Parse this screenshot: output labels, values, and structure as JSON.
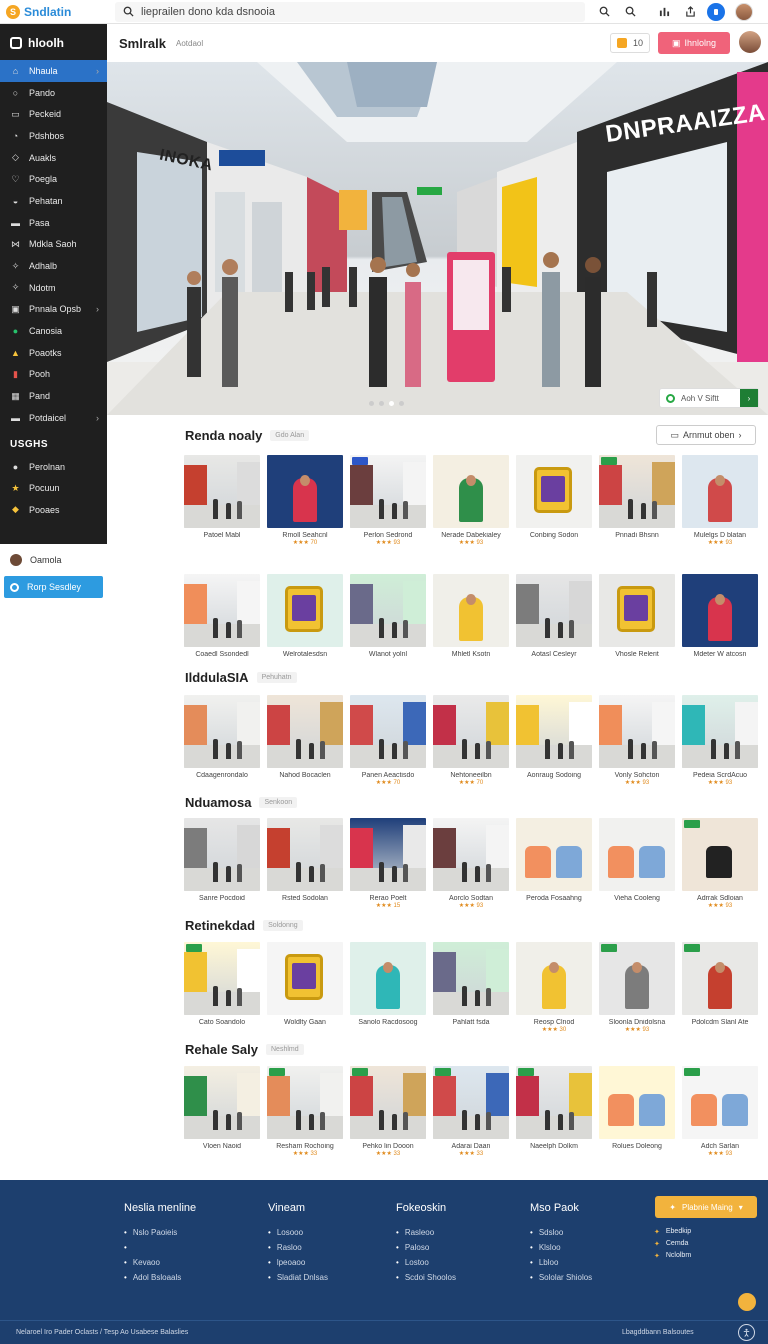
{
  "topbar": {
    "brand_letter": "S",
    "brand": "Sndlatin",
    "search_text": "lieprailen dono kda dsnooia"
  },
  "sidebar": {
    "header": "hloolh",
    "items": [
      {
        "label": "Nhaula",
        "icon": "home-icon",
        "active": true
      },
      {
        "label": "Pando",
        "icon": "circle-icon"
      },
      {
        "label": "Peckeid",
        "icon": "doc-icon"
      },
      {
        "label": "Pdshbos",
        "icon": "chat-icon"
      },
      {
        "label": "Auakls",
        "icon": "cart-icon"
      },
      {
        "label": "Poegla",
        "icon": "heart-icon"
      },
      {
        "label": "Pehatan",
        "icon": "bag-icon"
      },
      {
        "label": "Pasa",
        "icon": "card-icon"
      },
      {
        "label": "Mdkla Saoh",
        "icon": "filter-icon"
      },
      {
        "label": "Adhalb",
        "icon": "tool-icon"
      },
      {
        "label": "Ndotm",
        "icon": "tool-icon"
      },
      {
        "label": "Pnnala Opsb",
        "icon": "screen-icon"
      },
      {
        "label": "Canosia",
        "icon": "green-circle-icon"
      },
      {
        "label": "Poaotks",
        "icon": "yellow-icon"
      },
      {
        "label": "Pooh",
        "icon": "chart-icon"
      },
      {
        "label": "Pand",
        "icon": "grid-icon"
      },
      {
        "label": "Potdaicel",
        "icon": "card-icon"
      }
    ],
    "section": "USGHS",
    "section_items": [
      {
        "label": "Perolnan",
        "icon": "user-icon"
      },
      {
        "label": "Pocuun",
        "icon": "star-icon"
      },
      {
        "label": "Pooaes",
        "icon": "gift-icon"
      }
    ],
    "light_item": "Oamola",
    "button": "Rorp Sesdley"
  },
  "pagehead": {
    "title": "Smlralk",
    "sub": "Aotdaol",
    "chip_text": "10",
    "button": "Ihnlolng"
  },
  "hero": {
    "sign_main": "DNPRAAIZZA",
    "sign_left": "INOKA",
    "badge_text": "Aoh V Siftt",
    "dots": [
      false,
      false,
      true,
      false
    ]
  },
  "sections": [
    {
      "title": "Renda noaly",
      "tag": "Gdo Alan",
      "more": "Arnmut oben",
      "cards": [
        {
          "caption": "Patoel Mabl",
          "rating": ""
        },
        {
          "caption": "Rmoll Seahcnl",
          "rating": "★★★ 70"
        },
        {
          "caption": "Perlon Sedrond",
          "rating": "★★★ 93"
        },
        {
          "caption": "Nerade Dabekialey",
          "rating": "★★★ 93"
        },
        {
          "caption": "Conbing Sodon",
          "rating": ""
        },
        {
          "caption": "Pnnadi Bhsnn",
          "rating": ""
        },
        {
          "caption": "Mulelgs D blatan",
          "rating": "★★★ 93"
        }
      ]
    },
    {
      "title": "",
      "tag": "",
      "cards": [
        {
          "caption": "Coaedl Ssondedl",
          "rating": ""
        },
        {
          "caption": "Welrotalesdsn",
          "rating": ""
        },
        {
          "caption": "Wlanot yolnl",
          "rating": ""
        },
        {
          "caption": "Mhletl Ksotn",
          "rating": ""
        },
        {
          "caption": "Aotasl Cesleyr",
          "rating": ""
        },
        {
          "caption": "Vhosle Relerit",
          "rating": ""
        },
        {
          "caption": "Mdeter W atcosn",
          "rating": ""
        }
      ]
    },
    {
      "title": "IlddulaSIA",
      "tag": "Pehuhatn",
      "cards": [
        {
          "caption": "Cdaagenrondalo",
          "rating": ""
        },
        {
          "caption": "Nahod Bocaclen",
          "rating": ""
        },
        {
          "caption": "Panen Aeactisdo",
          "rating": "★★★ 70"
        },
        {
          "caption": "Nehtoneeilbn",
          "rating": "★★★ 70"
        },
        {
          "caption": "Aonraug Sodoing",
          "rating": ""
        },
        {
          "caption": "Vonly Sohcton",
          "rating": "★★★ 93"
        },
        {
          "caption": "Pedeia ScrdAcuo",
          "rating": "★★★ 93"
        }
      ]
    },
    {
      "title": "Nduamosa",
      "tag": "Senkoon",
      "cards": [
        {
          "caption": "Sanre Pocdoid",
          "rating": ""
        },
        {
          "caption": "Rsted Sodolan",
          "rating": ""
        },
        {
          "caption": "Rerao Poelt",
          "rating": "★★★ 15"
        },
        {
          "caption": "Aorclo Sodtan",
          "rating": "★★★ 93"
        },
        {
          "caption": "Peroda Fosaahng",
          "rating": ""
        },
        {
          "caption": "Vieha Cooleng",
          "rating": ""
        },
        {
          "caption": "Adrrak Sdloian",
          "rating": "★★★ 93"
        }
      ]
    },
    {
      "title": "Retinekdad",
      "tag": "Soldonng",
      "cards": [
        {
          "caption": "Cato Soandolo",
          "rating": ""
        },
        {
          "caption": "Woldlty Gaan",
          "rating": ""
        },
        {
          "caption": "Sanolo Racdosoog",
          "rating": ""
        },
        {
          "caption": "Pahlatt fsda",
          "rating": ""
        },
        {
          "caption": "Reosp Clnod",
          "rating": "★★★ 30"
        },
        {
          "caption": "Sloonla Dnidolsna",
          "rating": "★★★ 93"
        },
        {
          "caption": "Pdolcdm Slanl Ate",
          "rating": ""
        }
      ]
    },
    {
      "title": "Rehale Saly",
      "tag": "Neshlmd",
      "cards": [
        {
          "caption": "Vloen Naoid",
          "rating": ""
        },
        {
          "caption": "Resham Rochoing",
          "rating": "★★★ 33"
        },
        {
          "caption": "Pehko lin Dooon",
          "rating": "★★★ 33"
        },
        {
          "caption": "Adarai Daan",
          "rating": "★★★ 33"
        },
        {
          "caption": "Naeelph Dolkm",
          "rating": ""
        },
        {
          "caption": "Rolues Doleong",
          "rating": ""
        },
        {
          "caption": "Adch Sarlan",
          "rating": "★★★ 93"
        }
      ]
    }
  ],
  "footer": {
    "cols": [
      {
        "title": "Neslia menline",
        "items": [
          "Nslo Paoieis",
          "",
          "Kevaoo",
          "Adol Bsloaals"
        ]
      },
      {
        "title": "Vineam",
        "items": [
          "Losooo",
          "Rasloo",
          "lpeoaoo",
          "Sladiat Dnlsas"
        ]
      },
      {
        "title": "Fokeoskin",
        "items": [
          "Rasleoo",
          "Paloso",
          "Lostoo",
          "Scdoi Shoolos"
        ]
      },
      {
        "title": "Mso Paok",
        "items": [
          "Sdsloo",
          "Klsloo",
          "Lbloo",
          "Sololar Shiolos"
        ]
      }
    ],
    "button": "Plabnie Maing",
    "list": [
      "Ebedkip",
      "Cemda",
      "Nclolbm"
    ],
    "bottom_left": "Nelaroel Iro Pader Oclasts / Tesp Ao Usabese Balaslies",
    "bottom_right": "Lbagddbann Balsoutes"
  },
  "colors": {
    "accent": "#2b72c7",
    "brand": "#2a8bd8",
    "cta": "#f0637a",
    "footer": "#1d3f6e",
    "gold": "#f2b33d"
  }
}
